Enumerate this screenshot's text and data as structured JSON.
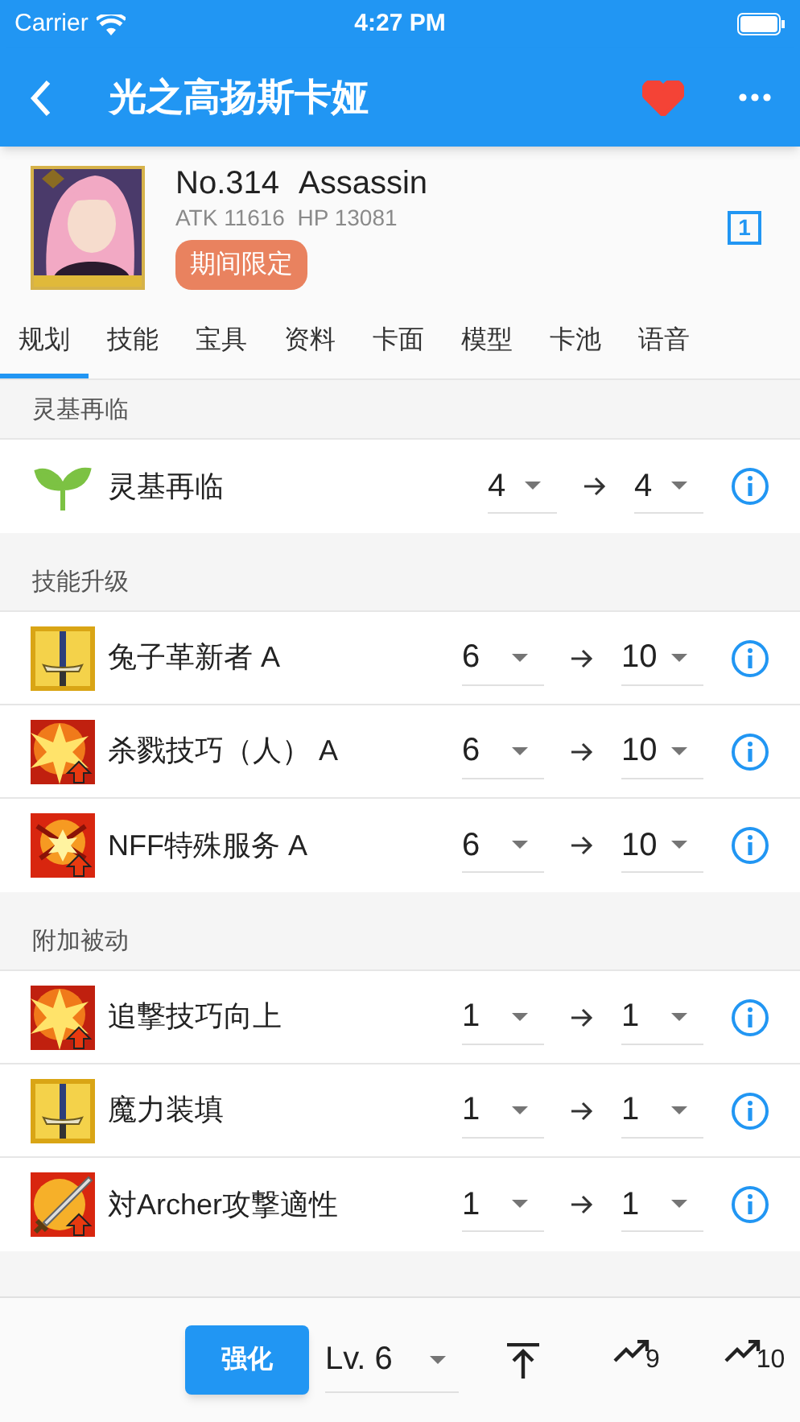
{
  "status_bar": {
    "carrier": "Carrier",
    "time": "4:27 PM"
  },
  "app_bar": {
    "title": "光之高扬斯卡娅",
    "favorite": true
  },
  "servant": {
    "number": "No.314",
    "class": "Assassin",
    "stats": "ATK 11616  HP 13081",
    "tag": "期间限定",
    "badge": "1"
  },
  "tabs": [
    {
      "label": "规划",
      "selected": true
    },
    {
      "label": "技能",
      "selected": false
    },
    {
      "label": "宝具",
      "selected": false
    },
    {
      "label": "资料",
      "selected": false
    },
    {
      "label": "卡面",
      "selected": false
    },
    {
      "label": "模型",
      "selected": false
    },
    {
      "label": "卡池",
      "selected": false
    },
    {
      "label": "语音",
      "selected": false
    }
  ],
  "sections": [
    {
      "title": "灵基再临",
      "rows": [
        {
          "kind": "sprout",
          "name": "灵基再临",
          "from": "4",
          "to": "4"
        }
      ]
    },
    {
      "title": "技能升级",
      "rows": [
        {
          "kind": "sword",
          "name": "兔子革新者 A",
          "from": "6",
          "to": "10"
        },
        {
          "kind": "burst",
          "name": "杀戮技巧（人） A",
          "from": "6",
          "to": "10"
        },
        {
          "kind": "clash",
          "name": "NFF特殊服务 A",
          "from": "6",
          "to": "10"
        }
      ]
    },
    {
      "title": "附加被动",
      "rows": [
        {
          "kind": "burst",
          "name": "追撃技巧向上",
          "from": "1",
          "to": "1"
        },
        {
          "kind": "sword",
          "name": "魔力装填",
          "from": "1",
          "to": "1"
        },
        {
          "kind": "blade",
          "name": "対Archer攻撃適性",
          "from": "1",
          "to": "1"
        }
      ]
    }
  ],
  "bottom_bar": {
    "button": "强化",
    "level": "Lv. 6",
    "plan_9": "9",
    "plan_10": "10"
  }
}
